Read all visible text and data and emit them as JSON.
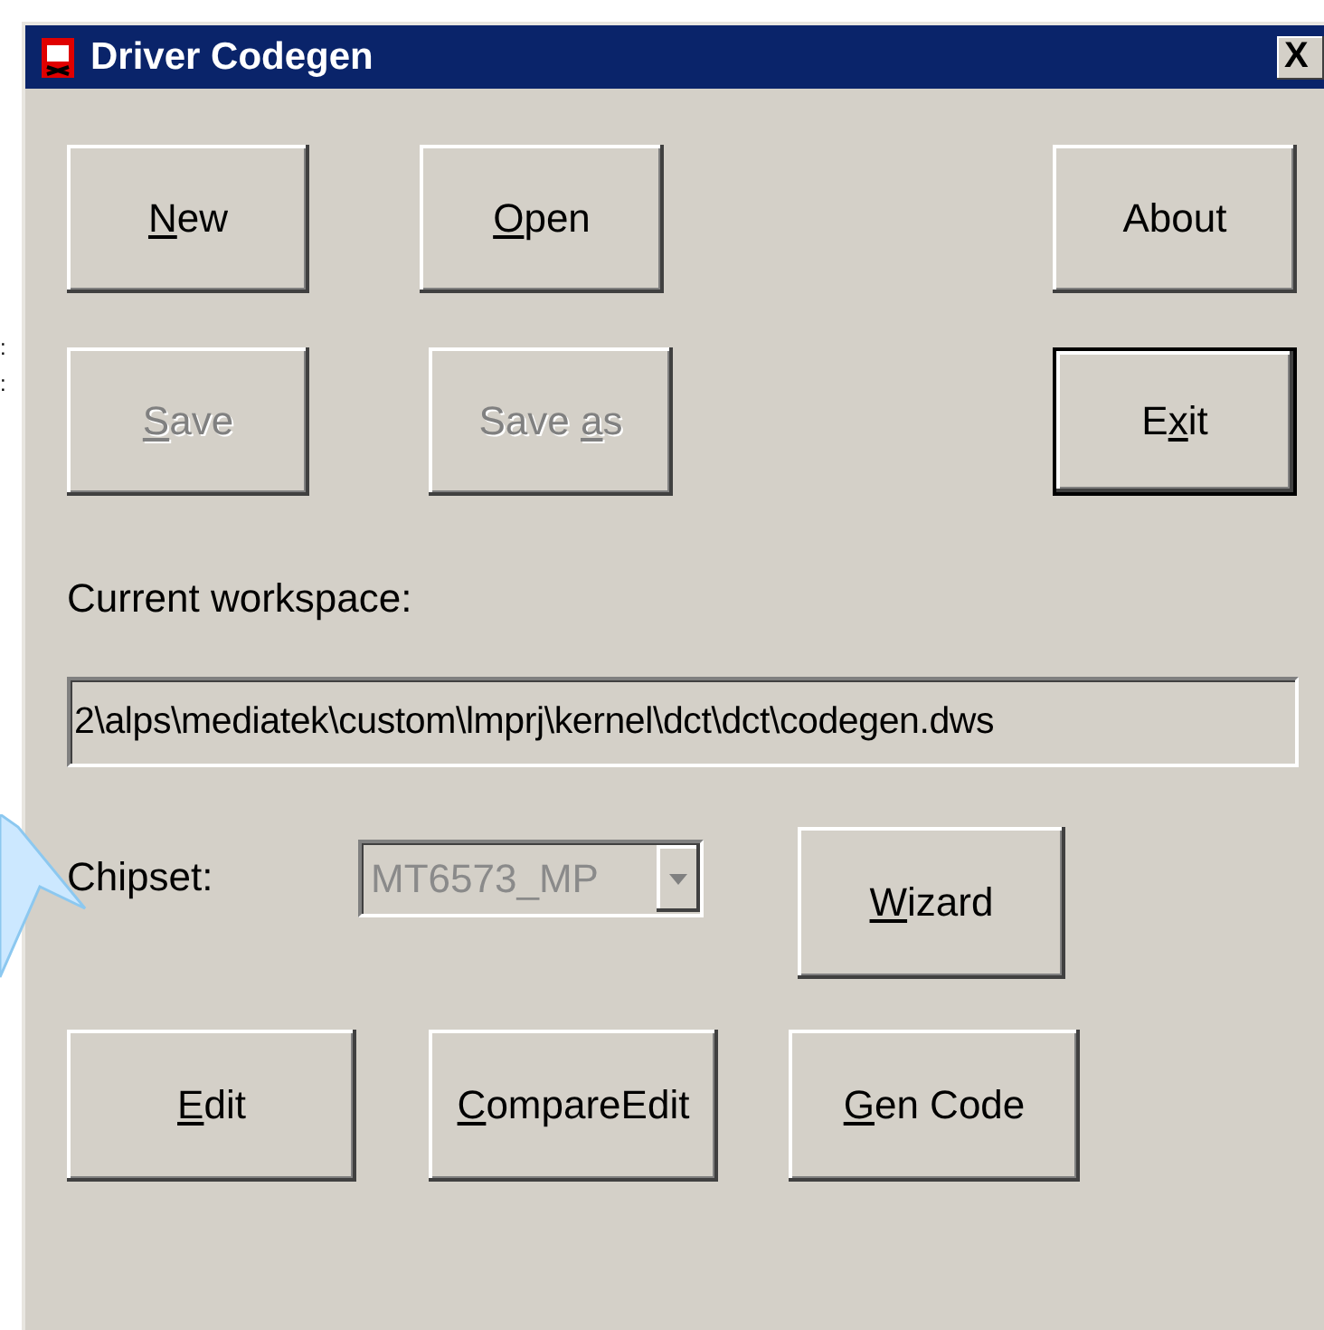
{
  "window": {
    "title": "Driver Codegen",
    "close": "X"
  },
  "edge_marks": [
    ":",
    ":"
  ],
  "buttons": {
    "new": {
      "key": "N",
      "post": "ew",
      "disabled": false,
      "default": false
    },
    "open": {
      "key": "O",
      "post": "pen",
      "disabled": false,
      "default": false
    },
    "about": {
      "pre": "About",
      "disabled": false,
      "default": false
    },
    "save": {
      "key": "S",
      "post": "ave",
      "disabled": true,
      "default": false
    },
    "save_as": {
      "pre": "Save ",
      "key": "a",
      "post": "s",
      "disabled": true,
      "default": false
    },
    "exit": {
      "pre": "E",
      "key": "x",
      "post": "it",
      "disabled": false,
      "default": true
    },
    "wizard": {
      "key": "W",
      "post": "izard",
      "disabled": false,
      "default": false
    },
    "edit": {
      "key": "E",
      "post": "dit",
      "disabled": false,
      "default": false
    },
    "compare_edit": {
      "key": "C",
      "post": "ompareEdit",
      "disabled": false,
      "default": false
    },
    "gen_code": {
      "key": "G",
      "post": "en Code",
      "disabled": false,
      "default": false
    }
  },
  "workspace": {
    "label": "Current workspace:",
    "value": "2\\alps\\mediatek\\custom\\lmprj\\kernel\\dct\\dct\\codegen.dws"
  },
  "chipset": {
    "label": "Chipset:",
    "value": "MT6573_MP",
    "disabled": true
  }
}
